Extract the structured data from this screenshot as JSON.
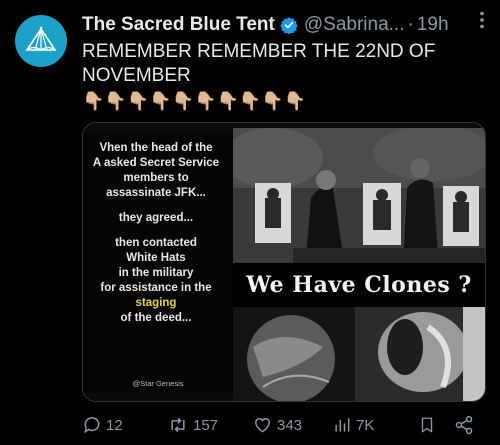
{
  "tweet": {
    "author_name": "The Sacred Blue Tent",
    "handle": "@Sabrina...",
    "separator": "·",
    "time": "19h",
    "text": "REMEMBER REMEMBER THE 22ND OF NOVEMBER",
    "emojis": "👇🏼👇🏼👇🏼👇🏼👇🏼👇🏼👇🏼👇🏼👇🏼👇🏼"
  },
  "media": {
    "caption_lines": [
      "Vhen the head of the",
      "A asked Secret Service",
      "members to",
      "assassinate JFK...",
      "they agreed...",
      "then contacted",
      "White Hats",
      "in the military",
      "for assistance in the"
    ],
    "caption_highlight": "staging",
    "caption_end": "of the deed...",
    "credit": "@Star Genesis",
    "banner": "We Have Clones ?"
  },
  "actions": {
    "replies": "12",
    "retweets": "157",
    "likes": "343",
    "views": "7K"
  },
  "colors": {
    "background": "#000000",
    "accent": "#1d9bf0",
    "muted": "#8b98a5",
    "avatar": "#1da1c8"
  }
}
